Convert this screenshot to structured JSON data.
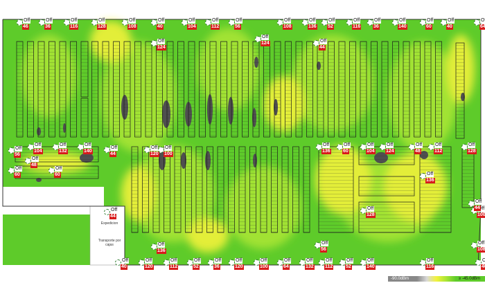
{
  "map": {
    "colors": {
      "heat_green": "#5ecb2a",
      "heat_lime": "#a9e534",
      "heat_yellow": "#f2f23a",
      "dead_zone": "#4f4f4f",
      "rack_stroke": "#1a1a1a",
      "ap_badge": "#d81b1b"
    },
    "room_labels": [
      "Expedicion",
      "Transporte por cajas"
    ],
    "legend": {
      "low_label": "-90.0dBm",
      "high_label": "≥ -45.0dBm",
      "gradient": [
        "#888888",
        "#d9d9d9",
        "#f2f23a",
        "#a9e534",
        "#5ecb2a"
      ]
    },
    "access_points": [
      {
        "state": "Off",
        "value": "46"
      },
      {
        "state": "Off",
        "value": "36"
      },
      {
        "state": "Off",
        "value": "116"
      },
      {
        "state": "Off",
        "value": "128"
      },
      {
        "state": "Off",
        "value": "108"
      },
      {
        "state": "Off",
        "value": "40"
      },
      {
        "state": "Off",
        "value": "104"
      },
      {
        "state": "Off",
        "value": "112"
      },
      {
        "state": "Off",
        "value": "56"
      },
      {
        "state": "Off",
        "value": "108"
      },
      {
        "state": "Off",
        "value": "136"
      },
      {
        "state": "Off",
        "value": "52"
      },
      {
        "state": "Off",
        "value": "116"
      },
      {
        "state": "Off",
        "value": "36"
      },
      {
        "state": "Off",
        "value": "140"
      },
      {
        "state": "Off",
        "value": "60"
      },
      {
        "state": "Off",
        "value": "40"
      },
      {
        "state": "Off",
        "value": "64"
      },
      {
        "state": "Off",
        "value": "124"
      },
      {
        "state": "Off",
        "value": "124"
      },
      {
        "state": "Off",
        "value": "44"
      },
      {
        "state": "Off",
        "value": "104"
      },
      {
        "state": "Off",
        "value": "132"
      },
      {
        "state": "Off",
        "value": "140"
      },
      {
        "state": "Off",
        "value": "48"
      },
      {
        "state": "Off",
        "value": "60"
      },
      {
        "state": "Off",
        "value": "44"
      },
      {
        "state": "Off",
        "value": "120"
      },
      {
        "state": "Off",
        "value": "100"
      },
      {
        "state": "Off",
        "value": "136"
      },
      {
        "state": "Off",
        "value": "60"
      },
      {
        "state": "Off",
        "value": "104"
      },
      {
        "state": "Off",
        "value": "124"
      },
      {
        "state": "Off",
        "value": "48"
      },
      {
        "state": "Off",
        "value": "112"
      },
      {
        "state": "Off",
        "value": "128"
      },
      {
        "state": "Off",
        "value": "136"
      },
      {
        "state": "Off",
        "value": "100"
      },
      {
        "state": "Off",
        "value": "44"
      },
      {
        "state": "Off",
        "value": "136"
      },
      {
        "state": "Off",
        "value": "56"
      },
      {
        "state": "Off",
        "value": "40"
      },
      {
        "state": "Off",
        "value": "120"
      },
      {
        "state": "Off",
        "value": "112"
      },
      {
        "state": "Off",
        "value": "52"
      },
      {
        "state": "Off",
        "value": "36"
      },
      {
        "state": "Off",
        "value": "120"
      },
      {
        "state": "Off",
        "value": "100"
      },
      {
        "state": "Off",
        "value": "64"
      },
      {
        "state": "Off",
        "value": "132"
      },
      {
        "state": "Off",
        "value": "112"
      },
      {
        "state": "Off",
        "value": "52"
      },
      {
        "state": "Off",
        "value": "140"
      },
      {
        "state": "Off",
        "value": "116"
      },
      {
        "state": "Off",
        "value": "108"
      },
      {
        "state": "Off",
        "value": "40"
      },
      {
        "state": "Off",
        "value": "128"
      },
      {
        "state": "Off",
        "value": "44"
      },
      {
        "state": "Off",
        "value": "56"
      },
      {
        "state": "Off",
        "value": "60"
      }
    ]
  }
}
